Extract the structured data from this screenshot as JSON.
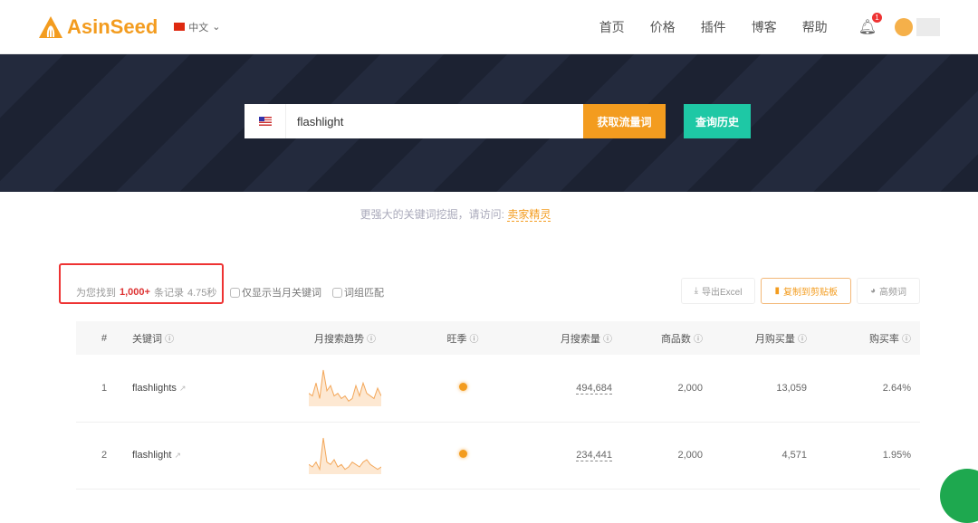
{
  "nav": {
    "brand": "AsinSeed",
    "lang": "中文",
    "menu": [
      "首页",
      "价格",
      "插件",
      "博客",
      "帮助"
    ],
    "notifications": "1"
  },
  "hero": {
    "query": "flashlight",
    "get_button": "获取流量词",
    "history_button": "查询历史",
    "hint": "更强大的关键词挖掘，请访问:",
    "hint_link": "卖家精灵"
  },
  "results": {
    "prefix": "为您找到",
    "count": "1,000+",
    "suffix": "条记录",
    "time": "4.75秒",
    "opt_month": "仅显示当月关键词",
    "opt_phrase": "词组匹配"
  },
  "tools": {
    "excel": "导出Excel",
    "copy": "复制到剪贴板",
    "freq": "高频词"
  },
  "table": {
    "headers": [
      "#",
      "关键词",
      "月搜索趋势",
      "旺季",
      "月搜索量",
      "商品数",
      "月购买量",
      "购买率"
    ],
    "rows": [
      {
        "n": "1",
        "kw": "flashlights",
        "trend": [
          5,
          4,
          9,
          3,
          14,
          6,
          8,
          4,
          5,
          3,
          4,
          2,
          3,
          8,
          4,
          9,
          5,
          4,
          3,
          7,
          4
        ],
        "volume": "494,684",
        "products": "2,000",
        "purchases": "13,059",
        "rate": "2.64%"
      },
      {
        "n": "2",
        "kw": "flashlight",
        "trend": [
          4,
          3,
          5,
          2,
          15,
          5,
          4,
          6,
          3,
          4,
          2,
          3,
          5,
          4,
          3,
          5,
          6,
          4,
          3,
          2,
          3
        ],
        "volume": "234,441",
        "products": "2,000",
        "purchases": "4,571",
        "rate": "1.95%"
      }
    ]
  },
  "colors": {
    "accent": "#f39c1f",
    "teal": "#1ec8a5",
    "red": "#e33"
  }
}
